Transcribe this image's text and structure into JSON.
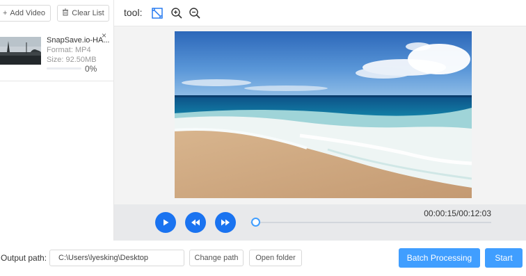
{
  "sidebar": {
    "add_video_label": "Add Video",
    "clear_list_label": "Clear List",
    "items": [
      {
        "name": "SnapSave.io-HA...",
        "format": "Format:  MP4",
        "size": "Size:  92.50MB",
        "progress_text": "0%",
        "progress": 0
      }
    ]
  },
  "toolbar": {
    "label": "tool:",
    "icons": [
      "crop-icon",
      "zoom-in-icon",
      "zoom-out-icon"
    ]
  },
  "player": {
    "time": "00:00:15/00:12:03",
    "position_seconds": 15,
    "duration_seconds": 723
  },
  "footer": {
    "output_label": "Output path:",
    "output_path": "C:\\Users\\lyesking\\Desktop",
    "change_path_label": "Change path",
    "open_folder_label": "Open folder",
    "batch_label": "Batch Processing",
    "start_label": "Start"
  },
  "colors": {
    "accent": "#409eff",
    "player_button": "#1a73f0"
  }
}
